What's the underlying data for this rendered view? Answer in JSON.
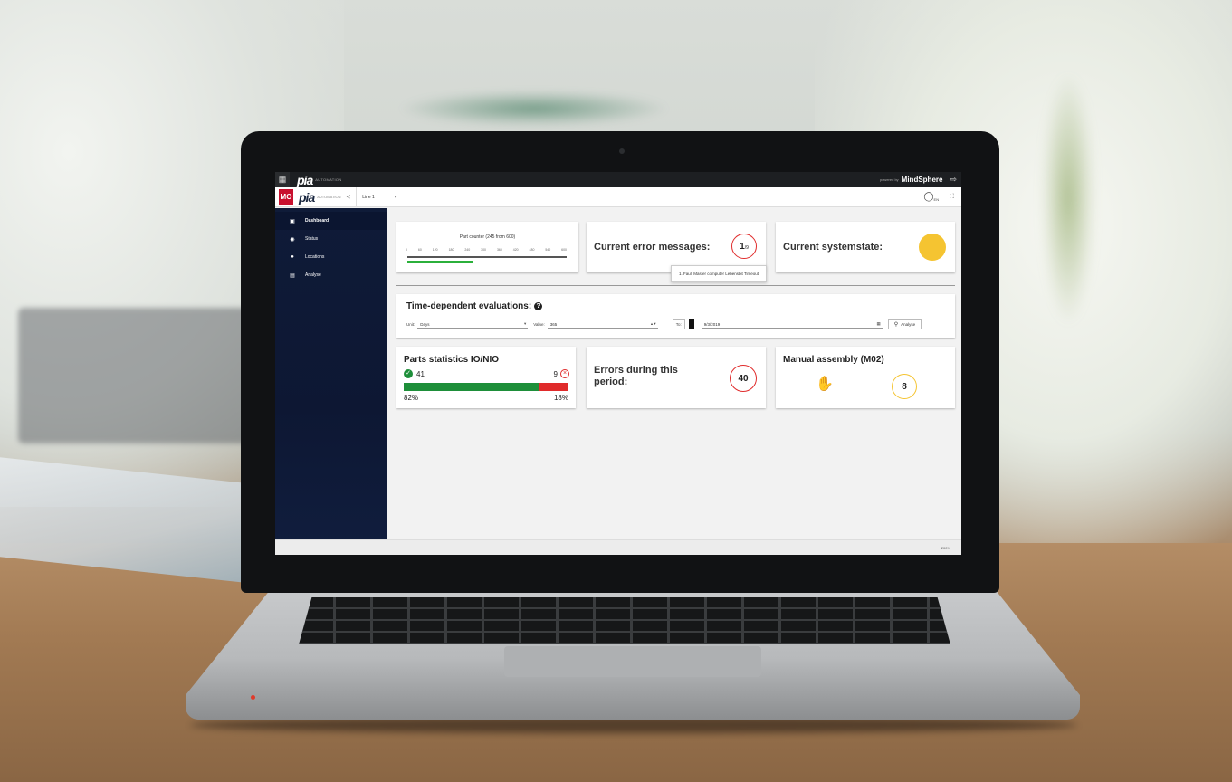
{
  "topbar": {
    "brand": "pia",
    "brand_sub": "AUTOMATION",
    "powered_by": "powered by",
    "platform": "MindSphere"
  },
  "appbar": {
    "badge": "MO",
    "brand": "pia",
    "brand_sub": "AUTOMATION",
    "line_select": "Line 1",
    "language": "EN"
  },
  "sidebar": {
    "items": [
      {
        "label": "Dashboard",
        "icon": "dashboard-icon",
        "active": true
      },
      {
        "label": "Status",
        "icon": "eye-icon"
      },
      {
        "label": "Locations",
        "icon": "location-pin-icon"
      },
      {
        "label": "Analyse",
        "icon": "bar-chart-icon"
      }
    ]
  },
  "part_counter": {
    "title": "Part counter (245 from 600)",
    "ticks": [
      "0",
      "60",
      "120",
      "180",
      "240",
      "300",
      "360",
      "420",
      "480",
      "540",
      "600"
    ],
    "progress": 0.408
  },
  "error_messages": {
    "label": "Current error messages:",
    "count": "1",
    "sub": "/9",
    "tooltip": "1. Fault Master computer Lebensbit Timeout"
  },
  "systemstate": {
    "label": "Current systemstate:",
    "color": "#f5c431"
  },
  "time_eval": {
    "title": "Time-dependent evaluations:",
    "unit_label": "Unit:",
    "unit_value": "Days",
    "value_label": "Value:",
    "value": "365",
    "to_label": "To:",
    "date": "9/3/2019",
    "analyse_button": "Analyse"
  },
  "parts_stats": {
    "title": "Parts statistics IO/NIO",
    "io_count": "41",
    "nio_count": "9",
    "io_percent": "82%",
    "nio_percent": "18%",
    "io_fraction": 0.82
  },
  "errors_period": {
    "label": "Errors during this period:",
    "count": "40"
  },
  "manual_assembly": {
    "title": "Manual assembly (M02)",
    "count": "8"
  },
  "statusbar": {
    "zoom": "200%"
  },
  "colors": {
    "sidebar": "#0f1b38",
    "ok_green": "#1e8f3a",
    "nok_red": "#e02b2b",
    "counter_green": "#2bb03b",
    "warning_yellow": "#f5c431",
    "error_ring": "#e02b2b"
  }
}
